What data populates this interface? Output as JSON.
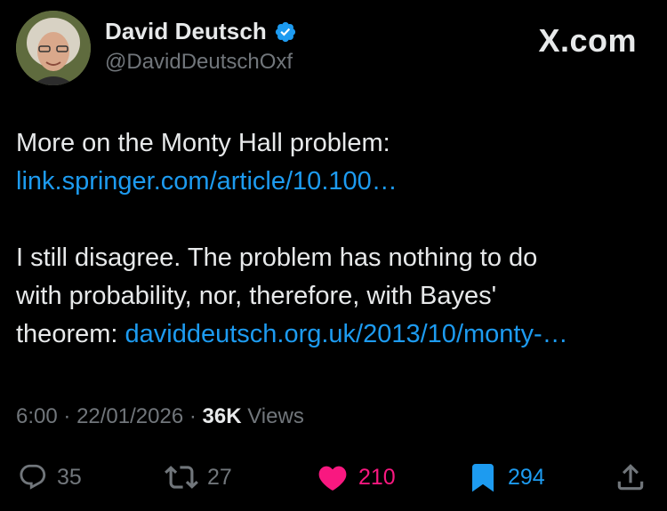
{
  "author": {
    "name": "David Deutsch",
    "handle": "@DavidDeutschOxf",
    "verified": true
  },
  "brand": "X.com",
  "tweet": {
    "line1": "More on the Monty Hall problem:",
    "link1": "link.springer.com/article/10.100…",
    "line2a": "I still disagree. The problem has nothing to do",
    "line2b": "with probability, nor, therefore, with Bayes'",
    "line2c_prefix": "theorem: ",
    "link2": "daviddeutsch.org.uk/2013/10/monty-…"
  },
  "meta": {
    "time": "6:00",
    "date": "22/01/2026",
    "views_count": "36K",
    "views_label": "Views"
  },
  "actions": {
    "replies": "35",
    "reposts": "27",
    "likes": "210",
    "bookmarks": "294"
  },
  "colors": {
    "background": "#000000",
    "text": "#e7e9ea",
    "secondary": "#71767b",
    "link": "#1d9bf0",
    "like": "#f91880"
  }
}
